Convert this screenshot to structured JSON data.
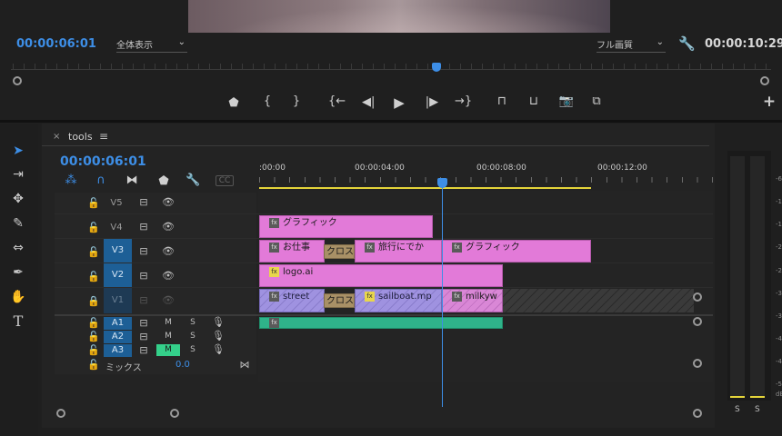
{
  "program_monitor": {
    "current_timecode": "00:00:06:01",
    "zoom_select": "全体表示",
    "quality_select": "フル画質",
    "duration_timecode": "00:00:10:29"
  },
  "transport": {
    "add_label": "+"
  },
  "timeline": {
    "panel_close": "×",
    "panel_title": "tools",
    "panel_menu": "≡",
    "timecode": "00:00:06:01",
    "ruler_labels": [
      ":00:00",
      "00:00:04:00",
      "00:00:08:00",
      "00:00:12:00"
    ],
    "video_tracks": [
      "V5",
      "V4",
      "V3",
      "V2",
      "V1"
    ],
    "audio_tracks": [
      "A1",
      "A2",
      "A3"
    ],
    "mute_label": "M",
    "solo_label": "S",
    "mix_label": "ミックス",
    "mix_value": "0.0",
    "clips": {
      "v4": "グラフィック",
      "v3a": "お仕事",
      "v3_trans": "クロス",
      "v3b": "旅行にでか",
      "v3c": "グラフィック",
      "v2": "logo.ai",
      "v1a": "street",
      "v1_trans": "クロス",
      "v1b": "sailboat.mp",
      "v1c": "milkyw"
    },
    "fx_label": "fx"
  },
  "meters": {
    "scale": [
      "-6",
      "-1",
      "-1",
      "-2",
      "-2",
      "-3",
      "-3",
      "-4",
      "-4",
      "-5"
    ],
    "db_label": "dB",
    "solo_left": "S",
    "solo_right": "S"
  }
}
